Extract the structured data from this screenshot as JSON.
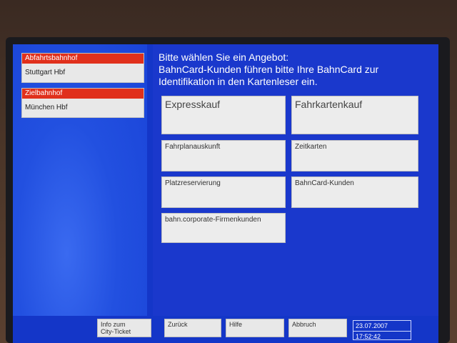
{
  "departure": {
    "label": "Abfahrtsbahnhof",
    "value": "Stuttgart Hbf"
  },
  "destination": {
    "label": "Zielbahnhof",
    "value": "München Hbf"
  },
  "prompt": {
    "line1": "Bitte wählen Sie ein Angebot:",
    "line2": "BahnCard-Kunden führen bitte Ihre BahnCard zur",
    "line3": "Identifikation in den Kartenleser ein."
  },
  "options": {
    "expresskauf": "Expresskauf",
    "fahrkartenkauf": "Fahrkartenkauf",
    "fahrplanauskunft": "Fahrplanauskunft",
    "zeitkarten": "Zeitkarten",
    "platzreservierung": "Platzreservierung",
    "bahncard_kunden": "BahnCard-Kunden",
    "firmenkunden": "bahn.corporate-Firmenkunden"
  },
  "bottom": {
    "city_ticket_line1": "Info zum",
    "city_ticket_line2": "City-Ticket",
    "zurueck": "Zurück",
    "hilfe": "Hilfe",
    "abbruch": "Abbruch",
    "date": "23.07.2007",
    "time": "17:52:42"
  },
  "colors": {
    "screen_blue": "#1436c8",
    "header_red": "#e0301c",
    "button_gray": "#ececec"
  }
}
